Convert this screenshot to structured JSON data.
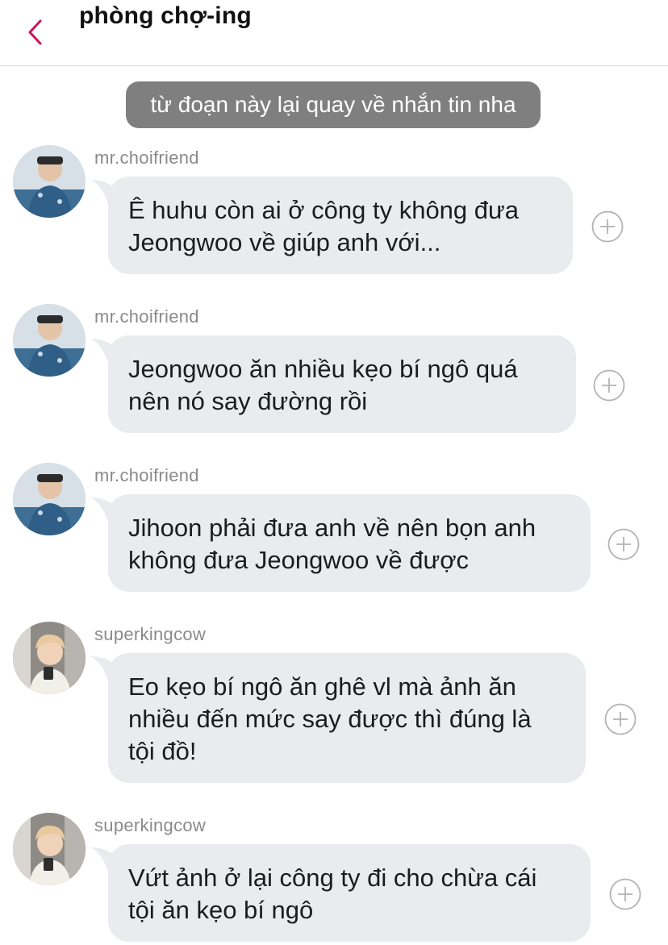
{
  "header": {
    "back_icon": "chevron-left-icon",
    "title": "phòng chợ-ing",
    "accent_color": "#c2185b"
  },
  "system_message": "từ đoạn này lại quay về nhắn tin nha",
  "messages": [
    {
      "sender": "mr.choifriend",
      "lines": [
        "Ê huhu còn ai ở công ty không đưa",
        "Jeongwoo về giúp anh với..."
      ]
    },
    {
      "sender": "mr.choifriend",
      "lines": [
        "Jeongwoo ăn nhiều kẹo bí ngô quá",
        "nên nó say đường rồi"
      ]
    },
    {
      "sender": "mr.choifriend",
      "lines": [
        "Jihoon phải đưa anh về nên bọn anh",
        "không đưa Jeongwoo về được"
      ]
    },
    {
      "sender": "superkingcow",
      "lines": [
        "Eo kẹo bí ngô ăn ghê vl mà ảnh ăn",
        "nhiều đến mức say được thì đúng là",
        "tội đồ!"
      ]
    },
    {
      "sender": "superkingcow",
      "lines": [
        "Vứt ảnh ở lại công ty đi cho chừa cái",
        "tội ăn kẹo bí ngô"
      ]
    }
  ],
  "colors": {
    "bubble": "#e9ebef",
    "system_pill": "#7f7f7f",
    "sender_text": "#8a8a8a"
  }
}
